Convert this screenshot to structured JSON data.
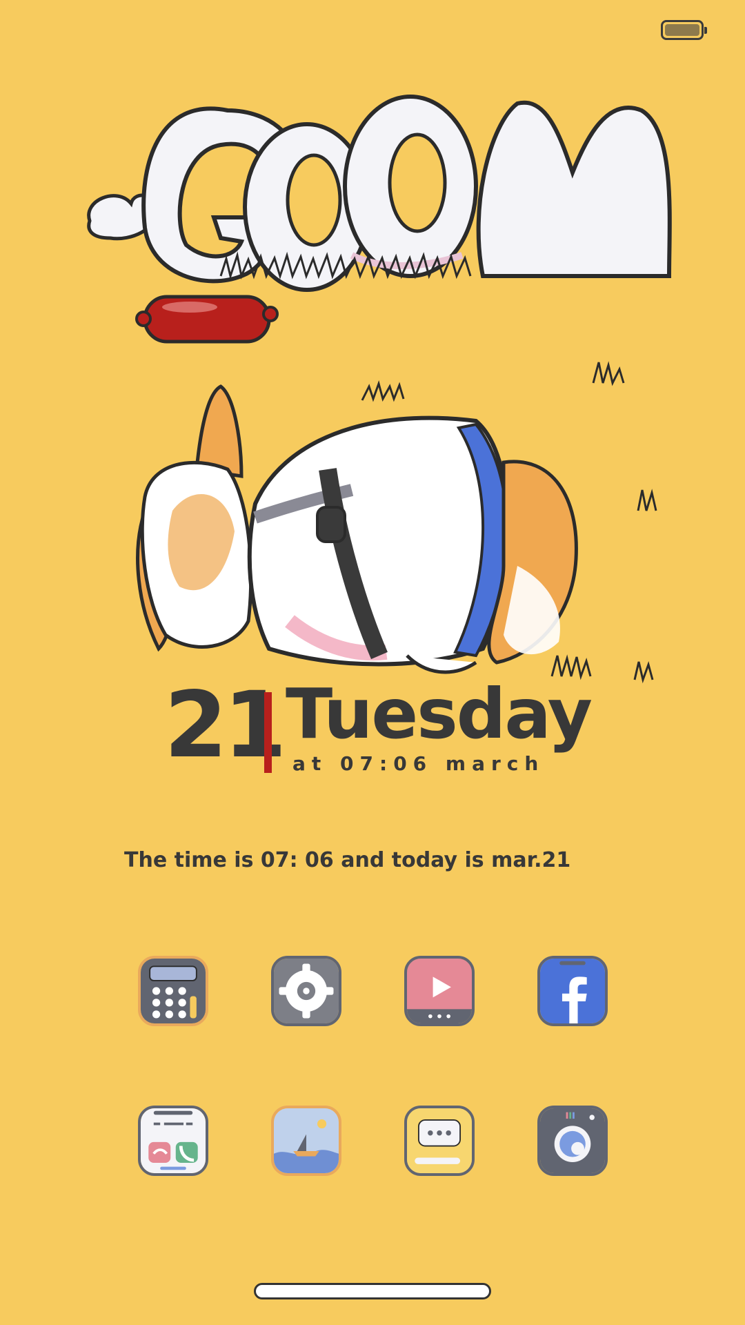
{
  "status_bar": {
    "battery": "battery-icon"
  },
  "widget": {
    "day_number": "21",
    "weekday": "Tuesday",
    "subline": "at 07:06 march",
    "sentence": "The time is 07: 06 and today is mar.21"
  },
  "apps": [
    {
      "id": "calculator",
      "icon": "calculator-icon"
    },
    {
      "id": "settings",
      "icon": "gear-icon"
    },
    {
      "id": "video",
      "icon": "play-icon"
    },
    {
      "id": "facebook",
      "icon": "facebook-icon"
    },
    {
      "id": "phone",
      "icon": "phone-icon"
    },
    {
      "id": "gallery",
      "icon": "photo-icon"
    },
    {
      "id": "messages",
      "icon": "message-icon"
    },
    {
      "id": "camera",
      "icon": "camera-icon"
    }
  ],
  "colors": {
    "background": "#F7CB5E",
    "text": "#383838",
    "divider": "#B8201C",
    "icon_border": "#616571"
  }
}
